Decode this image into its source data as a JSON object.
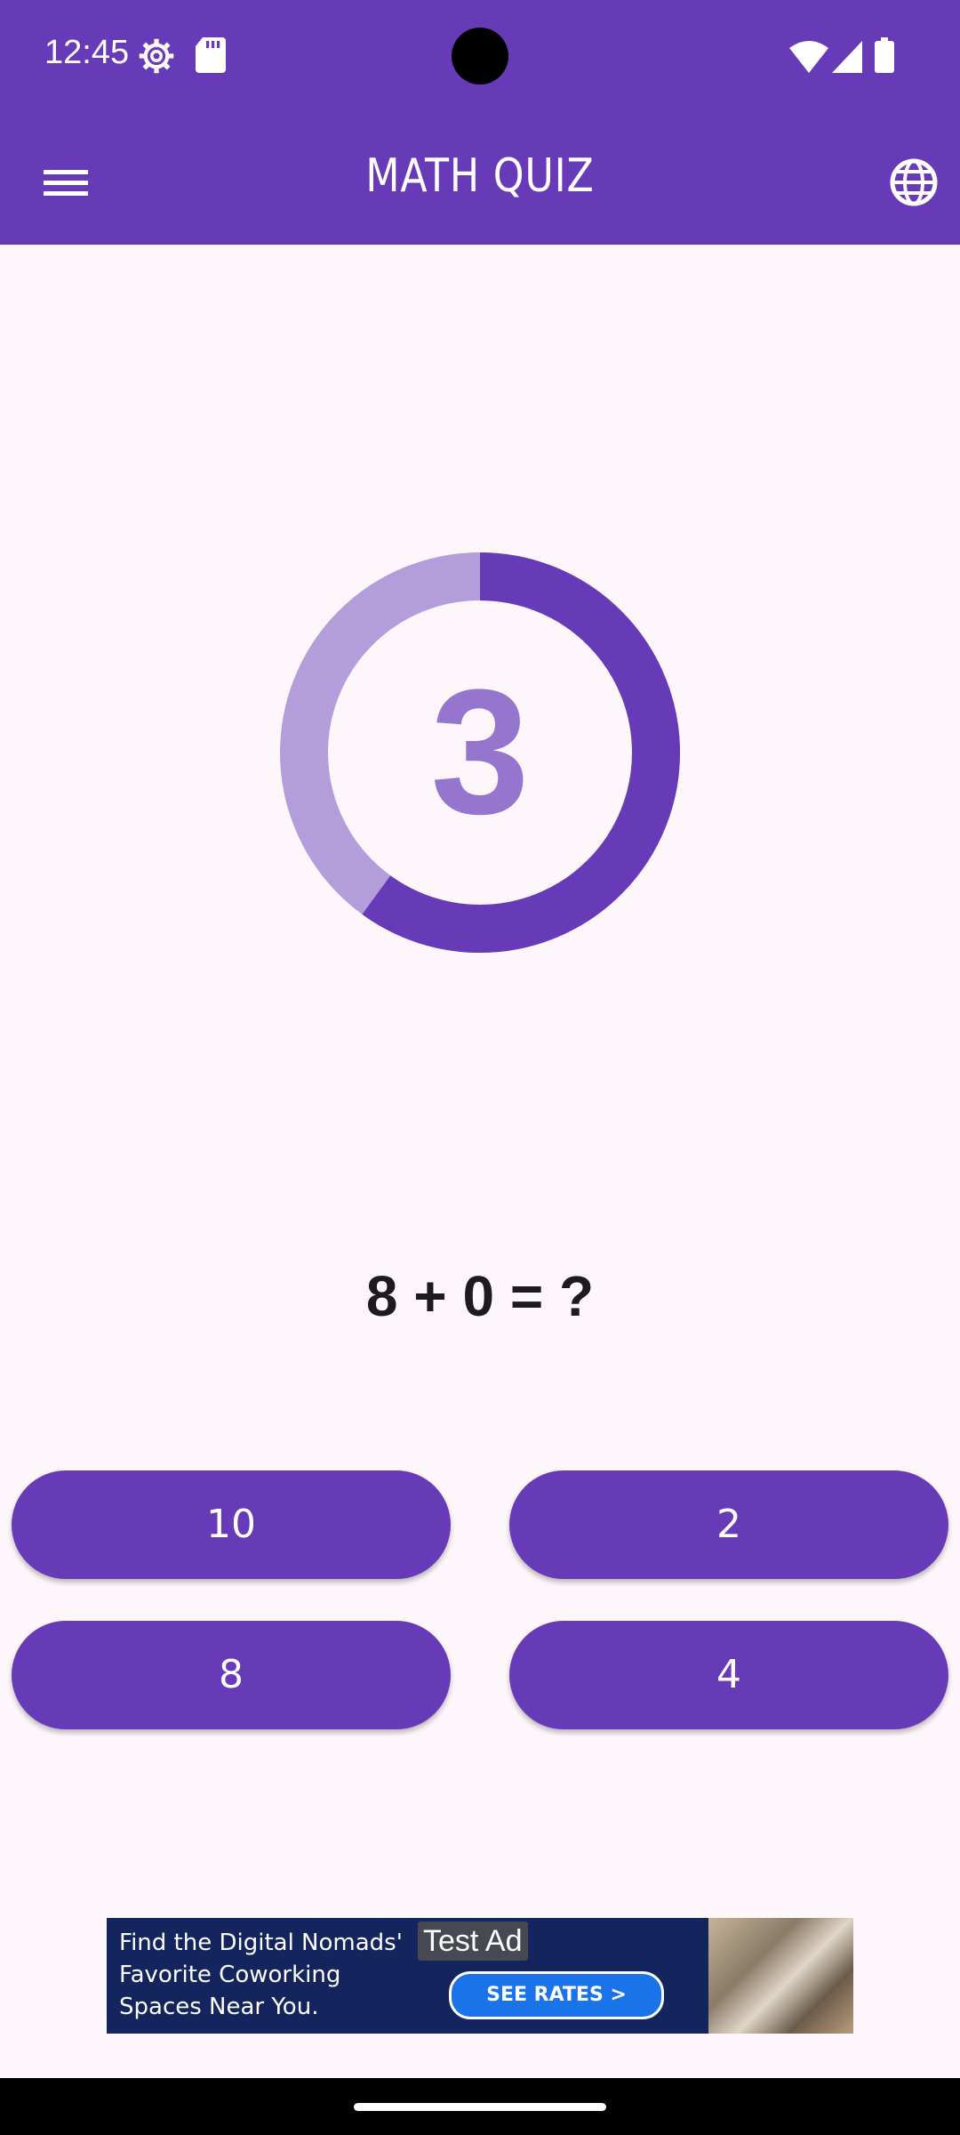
{
  "status_bar": {
    "time": "12:45",
    "icons": [
      "settings-icon",
      "sd-card-icon",
      "wifi-icon",
      "signal-icon",
      "battery-icon"
    ]
  },
  "app_bar": {
    "title": "MATH QUIZ",
    "menu_icon": "menu-icon",
    "language_icon": "globe-icon"
  },
  "timer": {
    "seconds_left": "3",
    "progress_fraction": 0.6,
    "track_color": "#b39ddb",
    "progress_color": "#673ab7"
  },
  "question": {
    "text": "8 + 0 = ?"
  },
  "answers": [
    "10",
    "2",
    "8",
    "4"
  ],
  "ad": {
    "label": "Test Ad",
    "headline": "Find the Digital Nomads'\nFavorite Coworking\nSpaces Near You.",
    "cta": "SEE RATES >"
  },
  "colors": {
    "primary": "#673ab7",
    "background": "#fdf7fb",
    "timer_number": "#9575cd"
  }
}
